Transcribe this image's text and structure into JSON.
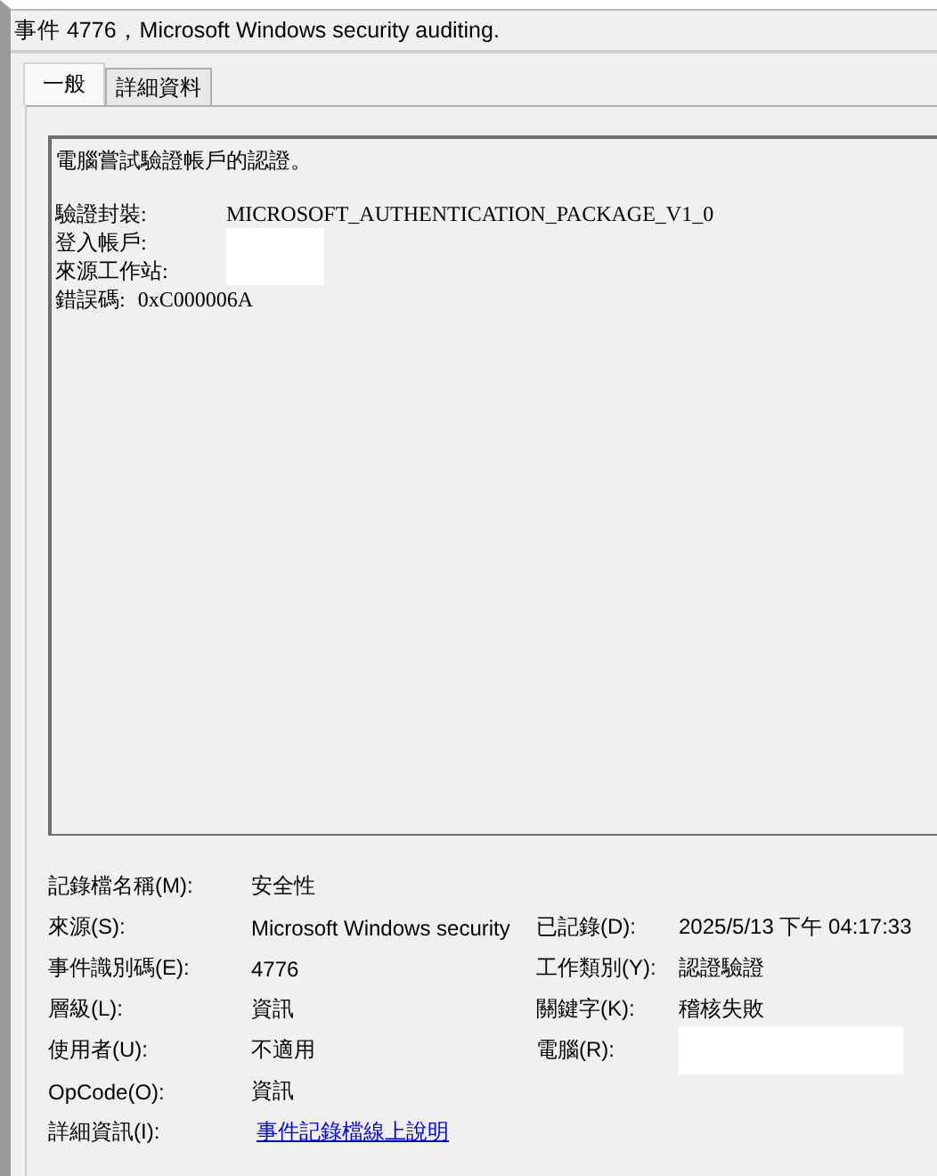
{
  "window": {
    "title": "事件 4776，Microsoft Windows security auditing."
  },
  "tabs": [
    {
      "label": "一般",
      "selected": true
    },
    {
      "label": "詳細資料",
      "selected": false
    }
  ],
  "description": {
    "summary": "電腦嘗試驗證帳戶的認證。",
    "entries": [
      {
        "kind": "column",
        "label": "驗證封裝:",
        "value": "MICROSOFT_AUTHENTICATION_PACKAGE_V1_0"
      },
      {
        "kind": "redacted",
        "label": "登入帳戶:"
      },
      {
        "kind": "redacted",
        "label": "來源工作站:"
      },
      {
        "kind": "inline",
        "label": "錯誤碼:",
        "value": "0xC000006A"
      }
    ]
  },
  "details": [
    [
      {
        "kind": "text",
        "label": "記錄檔名稱(M):",
        "value": "安全性"
      }
    ],
    [
      {
        "kind": "text",
        "label": "來源(S):",
        "value": "Microsoft Windows security"
      },
      {
        "kind": "text",
        "label": "已記錄(D):",
        "value": "2025/5/13 下午 04:17:33"
      }
    ],
    [
      {
        "kind": "text",
        "label": "事件識別碼(E):",
        "value": "4776"
      },
      {
        "kind": "text",
        "label": "工作類別(Y):",
        "value": "認證驗證"
      }
    ],
    [
      {
        "kind": "text",
        "label": "層級(L):",
        "value": "資訊"
      },
      {
        "kind": "text",
        "label": "關鍵字(K):",
        "value": "稽核失敗"
      }
    ],
    [
      {
        "kind": "text",
        "label": "使用者(U):",
        "value": "不適用"
      },
      {
        "kind": "redacted",
        "label": "電腦(R):"
      }
    ],
    [
      {
        "kind": "text",
        "label": "OpCode(O):",
        "value": "資訊"
      }
    ],
    [
      {
        "kind": "link",
        "label": "詳細資訊(I):",
        "value": "事件記錄檔線上說明"
      }
    ]
  ]
}
